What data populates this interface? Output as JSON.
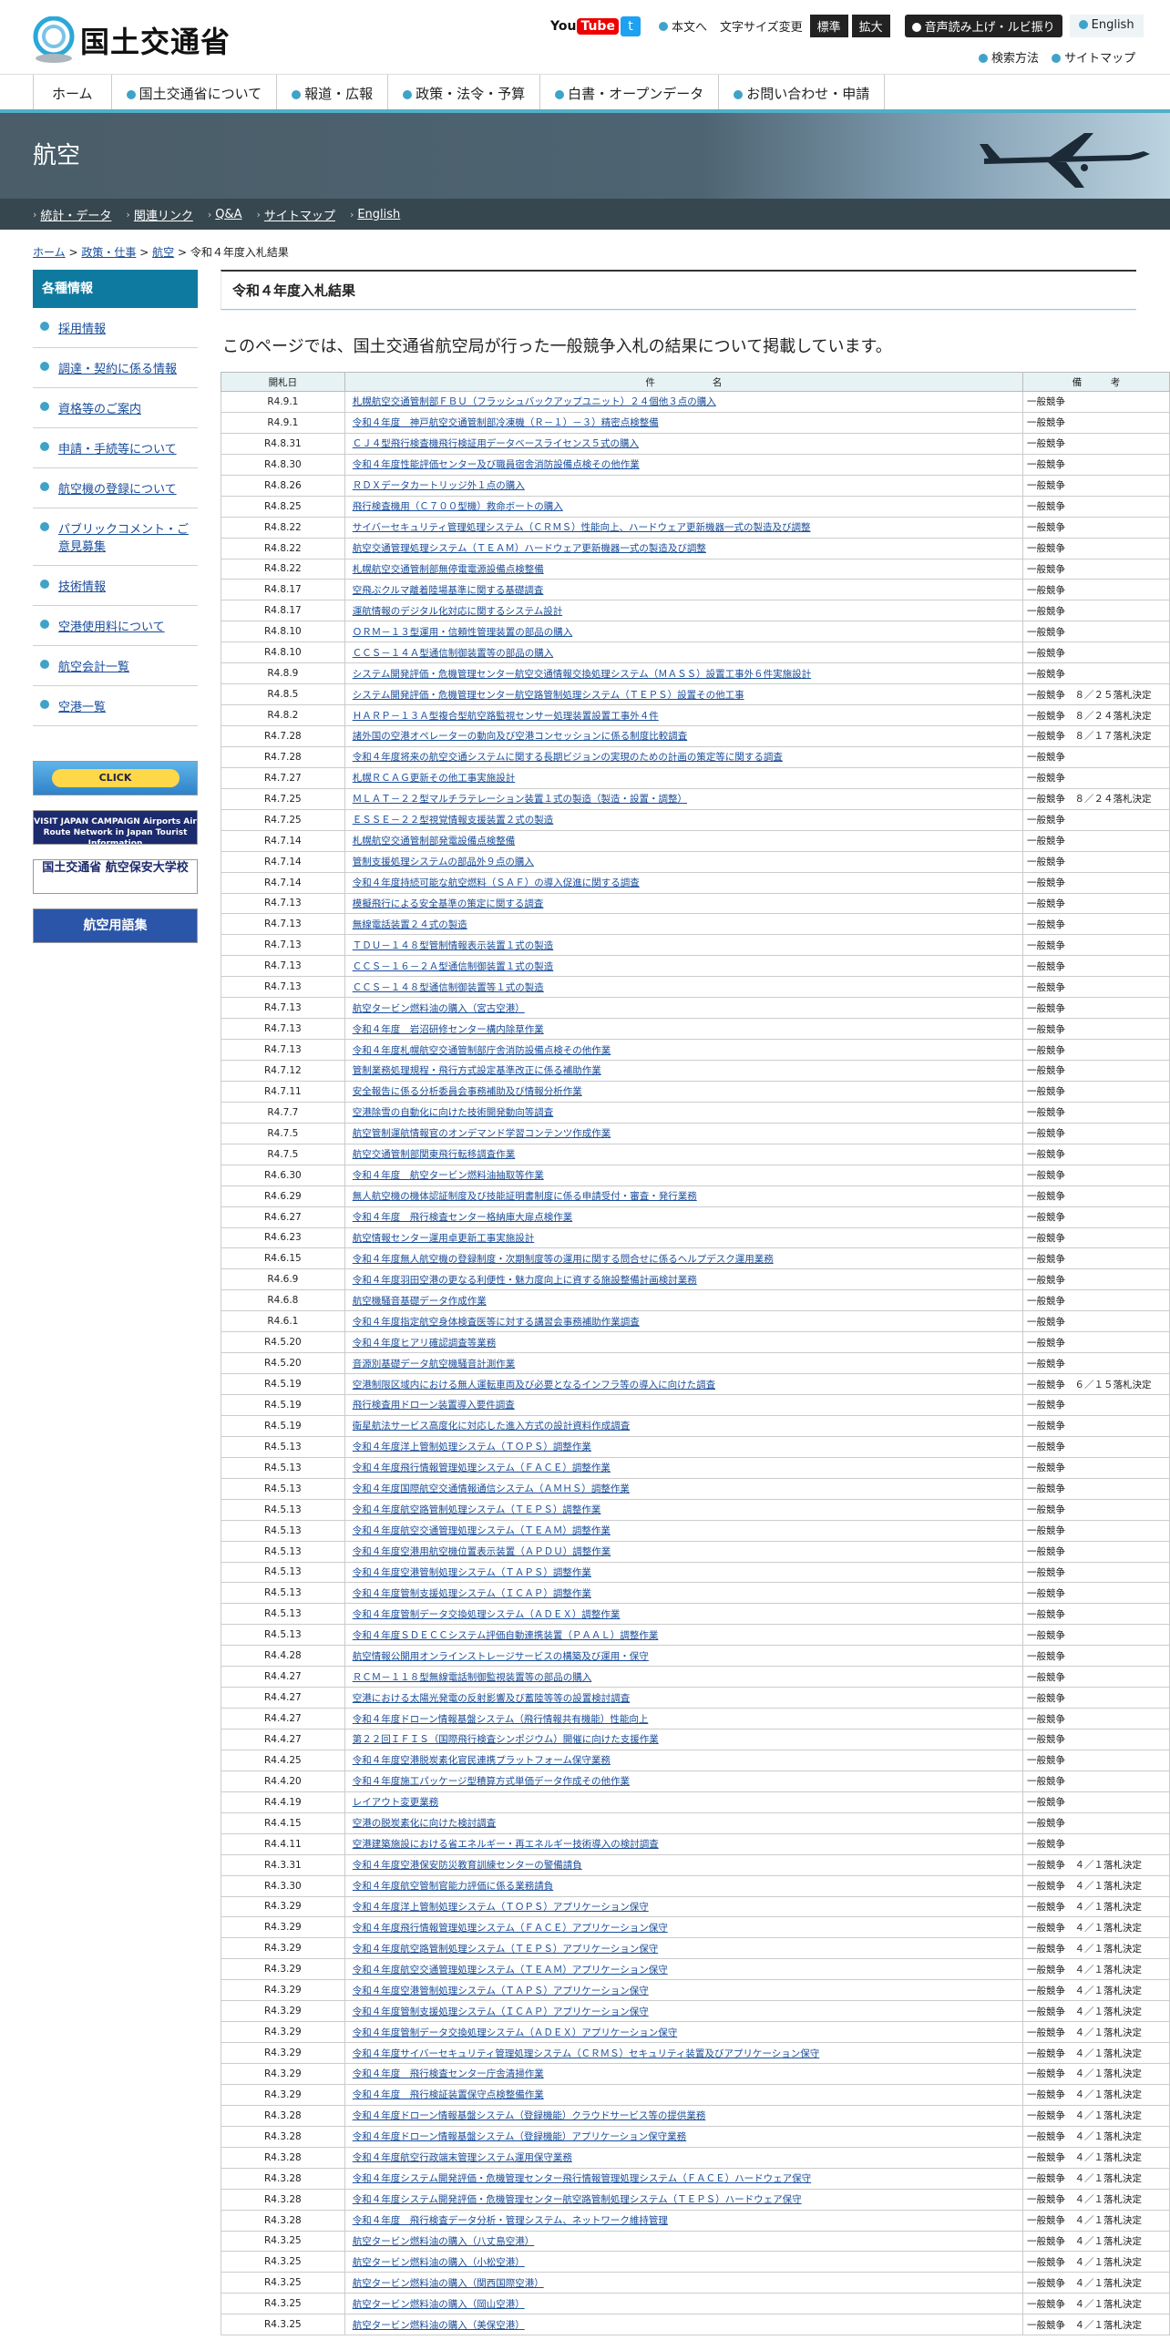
{
  "header": {
    "logo_text": "国土交通省",
    "youtube": "You",
    "youtube_tube": "Tube",
    "twitter": "t",
    "honbun": "本文へ",
    "fontsize": "文字サイズ変更",
    "std": "標準",
    "large": "拡大",
    "voice": "音声読み上げ・ルビ振り",
    "english": "English",
    "search": "検索方法",
    "sitemap": "サイトマップ"
  },
  "gnav": [
    "ホーム",
    "国土交通省について",
    "報道・広報",
    "政策・法令・予算",
    "白書・オープンデータ",
    "お問い合わせ・申請"
  ],
  "banner": {
    "title": "航空"
  },
  "subnav": [
    "統計・データ",
    "関連リンク",
    "Q&A",
    "サイトマップ",
    "English"
  ],
  "crumbs": {
    "home": "ホーム",
    "policy": "政策・仕事",
    "aviation": "航空",
    "current": "令和４年度入札結果",
    "sep": ">"
  },
  "sidebar": {
    "header": "各種情報",
    "items": [
      "採用情報",
      "調達・契約に係る情報",
      "資格等のご案内",
      "申請・手続等について",
      "航空機の登録について",
      "パブリックコメント・ご意見募集",
      "技術情報",
      "空港使用料について",
      "航空会計一覧",
      "空港一覧"
    ],
    "banners": [
      "CLICK",
      "VISIT JAPAN CAMPAIGN Airports Air Route Network in Japan Tourist Information",
      "国土交通省 航空保安大学校",
      "航空用語集"
    ]
  },
  "main": {
    "title": "令和４年度入札結果",
    "intro": "このページでは、国土交通省航空局が行った一般競争入札の結果について掲載しています。",
    "th": [
      "開札日",
      "件　　　　　　名",
      "備　　　考"
    ]
  },
  "rows": [
    [
      "R4.9.1",
      "札幌航空交通管制部ＦＢＵ（フラッシュバックアップユニット）２４個他３点の購入",
      "一般競争"
    ],
    [
      "R4.9.1",
      "令和４年度　神戸航空交通管制部冷凍機（Ｒ－１）－３）精密点検整備",
      "一般競争"
    ],
    [
      "R4.8.31",
      "ＣＪ４型飛行検査機飛行検証用データベースライセンス５式の購入",
      "一般競争"
    ],
    [
      "R4.8.30",
      "令和４年度性能評価センター及び職員宿舎消防設備点検その他作業",
      "一般競争"
    ],
    [
      "R4.8.26",
      "ＲＤＸデータカートリッジ外１点の購入",
      "一般競争"
    ],
    [
      "R4.8.25",
      "飛行検査機用（Ｃ７００型機）救命ボートの購入",
      "一般競争"
    ],
    [
      "R4.8.22",
      "サイバーセキュリティ管理処理システム（ＣＲＭＳ）性能向上、ハードウェア更新機器一式の製造及び調整",
      "一般競争"
    ],
    [
      "R4.8.22",
      "航空交通管理処理システム（ＴＥＡＭ）ハードウェア更新機器一式の製造及び調整",
      "一般競争"
    ],
    [
      "R4.8.22",
      "札幌航空交通管制部無停電電源設備点検整備",
      "一般競争"
    ],
    [
      "R4.8.17",
      "空飛ぶクルマ離着陸場基準に関する基礎調査",
      "一般競争"
    ],
    [
      "R4.8.17",
      "運航情報のデジタル化対応に関するシステム設計",
      "一般競争"
    ],
    [
      "R4.8.10",
      "ＯＲＭ－１３型運用・信頼性管理装置の部品の購入",
      "一般競争"
    ],
    [
      "R4.8.10",
      "ＣＣＳ－１４Ａ型通信制御装置等の部品の購入",
      "一般競争"
    ],
    [
      "R4.8.9",
      "システム開発評価・危機管理センター航空交通情報交換処理システム（ＭＡＳＳ）設置工事外６件実施設計",
      "一般競争"
    ],
    [
      "R4.8.5",
      "システム開発評価・危機管理センター航空路管制処理システム（ＴＥＰＳ）設置その他工事",
      "一般競争　８／２５落札決定"
    ],
    [
      "R4.8.2",
      "ＨＡＲＰ－１３Ａ型複合型航空路監視センサー処理装置設置工事外４件",
      "一般競争　８／２４落札決定"
    ],
    [
      "R4.7.28",
      "諸外国の空港オペレーターの動向及び空港コンセッションに係る制度比較調査",
      "一般競争　８／１７落札決定"
    ],
    [
      "R4.7.28",
      "令和４年度将来の航空交通システムに関する長期ビジョンの実現のための計画の策定等に関する調査",
      "一般競争"
    ],
    [
      "R4.7.27",
      "札幌ＲＣＡＧ更新その他工事実施設計",
      "一般競争"
    ],
    [
      "R4.7.25",
      "ＭＬＡＴ－２２型マルチラテレーション装置１式の製造（製造・設置・調整）",
      "一般競争　８／２４落札決定"
    ],
    [
      "R4.7.25",
      "ＥＳＳＥ－２２型視覚情報支援装置２式の製造",
      "一般競争"
    ],
    [
      "R4.7.14",
      "札幌航空交通管制部発電設備点検整備",
      "一般競争"
    ],
    [
      "R4.7.14",
      "管制支援処理システムの部品外９点の購入",
      "一般競争"
    ],
    [
      "R4.7.14",
      "令和４年度持続可能な航空燃料（ＳＡＦ）の導入促進に関する調査",
      "一般競争"
    ],
    [
      "R4.7.13",
      "模擬飛行による安全基準の策定に関する調査",
      "一般競争"
    ],
    [
      "R4.7.13",
      "無線電話装置２４式の製造",
      "一般競争"
    ],
    [
      "R4.7.13",
      "ＴＤＵ－１４８型管制情報表示装置１式の製造",
      "一般競争"
    ],
    [
      "R4.7.13",
      "ＣＣＳ－１６－２Ａ型通信制御装置１式の製造",
      "一般競争"
    ],
    [
      "R4.7.13",
      "ＣＣＳ－１４８型通信制御装置等１式の製造",
      "一般競争"
    ],
    [
      "R4.7.13",
      "航空タービン燃料油の購入（宮古空港）",
      "一般競争"
    ],
    [
      "R4.7.13",
      "令和４年度　岩沼研修センター構内除草作業",
      "一般競争"
    ],
    [
      "R4.7.13",
      "令和４年度札幌航空交通管制部庁舎消防設備点検その他作業",
      "一般競争"
    ],
    [
      "R4.7.12",
      "管制業務処理規程・飛行方式設定基準改正に係る補助作業",
      "一般競争"
    ],
    [
      "R4.7.11",
      "安全報告に係る分析委員会事務補助及び情報分析作業",
      "一般競争"
    ],
    [
      "R4.7.7",
      "空港除雪の自動化に向けた技術開発動向等調査",
      "一般競争"
    ],
    [
      "R4.7.5",
      "航空管制運航情報官のオンデマンド学習コンテンツ作成作業",
      "一般競争"
    ],
    [
      "R4.7.5",
      "航空交通管制部関東飛行転移調査作業",
      "一般競争"
    ],
    [
      "R4.6.30",
      "令和４年度　航空タービン燃料油抽取等作業",
      "一般競争"
    ],
    [
      "R4.6.29",
      "無人航空機の機体認証制度及び技能証明書制度に係る申請受付・審査・発行業務",
      "一般競争"
    ],
    [
      "R4.6.27",
      "令和４年度　飛行検査センター格納庫大扉点検作業",
      "一般競争"
    ],
    [
      "R4.6.23",
      "航空情報センター運用卓更新工事実施設計",
      "一般競争"
    ],
    [
      "R4.6.15",
      "令和４年度無人航空機の登録制度・次期制度等の運用に関する問合せに係るヘルプデスク運用業務",
      "一般競争"
    ],
    [
      "R4.6.9",
      "令和４年度羽田空港の更なる利便性・魅力度向上に資する施設整備計画検討業務",
      "一般競争"
    ],
    [
      "R4.6.8",
      "航空機騒音基礎データ作成作業",
      "一般競争"
    ],
    [
      "R4.6.1",
      "令和４年度指定航空身体検査医等に対する講習会事務補助作業調査",
      "一般競争"
    ],
    [
      "R4.5.20",
      "令和４年度ヒアリ確認調査等業務",
      "一般競争"
    ],
    [
      "R4.5.20",
      "音源別基礎データ航空機騒音計測作業",
      "一般競争"
    ],
    [
      "R4.5.19",
      "空港制限区域内における無人運転車両及び必要となるインフラ等の導入に向けた調査",
      "一般競争　６／１５落札決定"
    ],
    [
      "R4.5.19",
      "飛行検査用ドローン装置導入要件調査",
      "一般競争"
    ],
    [
      "R4.5.19",
      "衛星航法サービス高度化に対応した進入方式の設計資料作成調査",
      "一般競争"
    ],
    [
      "R4.5.13",
      "令和４年度洋上管制処理システム（ＴＯＰＳ）調整作業",
      "一般競争"
    ],
    [
      "R4.5.13",
      "令和４年度飛行情報管理処理システム（ＦＡＣＥ）調整作業",
      "一般競争"
    ],
    [
      "R4.5.13",
      "令和４年度国際航空交通情報通信システム（ＡＭＨＳ）調整作業",
      "一般競争"
    ],
    [
      "R4.5.13",
      "令和４年度航空路管制処理システム（ＴＥＰＳ）調整作業",
      "一般競争"
    ],
    [
      "R4.5.13",
      "令和４年度航空交通管理処理システム（ＴＥＡＭ）調整作業",
      "一般競争"
    ],
    [
      "R4.5.13",
      "令和４年度空港用航空機位置表示装置（ＡＰＤＵ）調整作業",
      "一般競争"
    ],
    [
      "R4.5.13",
      "令和４年度空港管制処理システム（ＴＡＰＳ）調整作業",
      "一般競争"
    ],
    [
      "R4.5.13",
      "令和４年度管制支援処理システム（ＩＣＡＰ）調整作業",
      "一般競争"
    ],
    [
      "R4.5.13",
      "令和４年度管制データ交換処理システム（ＡＤＥＸ）調整作業",
      "一般競争"
    ],
    [
      "R4.5.13",
      "令和４年度ＳＤＥＣＣシステム評価自動連携装置（ＰＡＡＬ）調整作業",
      "一般競争"
    ],
    [
      "R4.4.28",
      "航空情報公開用オンラインストレージサービスの構築及び運用・保守",
      "一般競争"
    ],
    [
      "R4.4.27",
      "ＲＣＭ－１１８型無線電話制御監視装置等の部品の購入",
      "一般競争"
    ],
    [
      "R4.4.27",
      "空港における太陽光発電の反射影響及び蓄陸等等の設置検討調査",
      "一般競争"
    ],
    [
      "R4.4.27",
      "令和４年度ドローン情報基盤システム（飛行情報共有機能）性能向上",
      "一般競争"
    ],
    [
      "R4.4.27",
      "第２２回ＩＦＩＳ（国際飛行検査シンポジウム）開催に向けた支援作業",
      "一般競争"
    ],
    [
      "R4.4.25",
      "令和４年度空港脱炭素化官民連携プラットフォーム保守業務",
      "一般競争"
    ],
    [
      "R4.4.20",
      "令和４年度施工パッケージ型積算方式単価データ作成その他作業",
      "一般競争"
    ],
    [
      "R4.4.19",
      "レイアウト変更業務",
      "一般競争"
    ],
    [
      "R4.4.15",
      "空港の脱炭素化に向けた検討調査",
      "一般競争"
    ],
    [
      "R4.4.11",
      "空港建築施設における省エネルギー・再エネルギー技術導入の検討調査",
      "一般競争"
    ],
    [
      "R4.3.31",
      "令和４年度空港保安防災教育訓練センターの警備請負",
      "一般競争　４／１落札決定"
    ],
    [
      "R4.3.30",
      "令和４年度航空管制官能力評価に係る業務請負",
      "一般競争　４／１落札決定"
    ],
    [
      "R4.3.29",
      "令和４年度洋上管制処理システム（ＴＯＰＳ）アプリケーション保守",
      "一般競争　４／１落札決定"
    ],
    [
      "R4.3.29",
      "令和４年度飛行情報管理処理システム（ＦＡＣＥ）アプリケーション保守",
      "一般競争　４／１落札決定"
    ],
    [
      "R4.3.29",
      "令和４年度航空路管制処理システム（ＴＥＰＳ）アプリケーション保守",
      "一般競争　４／１落札決定"
    ],
    [
      "R4.3.29",
      "令和４年度航空交通管理処理システム（ＴＥＡＭ）アプリケーション保守",
      "一般競争　４／１落札決定"
    ],
    [
      "R4.3.29",
      "令和４年度空港管制処理システム（ＴＡＰＳ）アプリケーション保守",
      "一般競争　４／１落札決定"
    ],
    [
      "R4.3.29",
      "令和４年度管制支援処理システム（ＩＣＡＰ）アプリケーション保守",
      "一般競争　４／１落札決定"
    ],
    [
      "R4.3.29",
      "令和４年度管制データ交換処理システム（ＡＤＥＸ）アプリケーション保守",
      "一般競争　４／１落札決定"
    ],
    [
      "R4.3.29",
      "令和４年度サイバーセキュリティ管理処理システム（ＣＲＭＳ）セキュリティ装置及びアプリケーション保守",
      "一般競争　４／１落札決定"
    ],
    [
      "R4.3.29",
      "令和４年度　飛行検査センター庁舎清掃作業",
      "一般競争　４／１落札決定"
    ],
    [
      "R4.3.29",
      "令和４年度　飛行検証装置保守点検整備作業",
      "一般競争　４／１落札決定"
    ],
    [
      "R4.3.28",
      "令和４年度ドローン情報基盤システム（登録機能）クラウドサービス等の提供業務",
      "一般競争　４／１落札決定"
    ],
    [
      "R4.3.28",
      "令和４年度ドローン情報基盤システム（登録機能）アプリケーション保守業務",
      "一般競争　４／１落札決定"
    ],
    [
      "R4.3.28",
      "令和４年度航空行政端末管理システム運用保守業務",
      "一般競争　４／１落札決定"
    ],
    [
      "R4.3.28",
      "令和４年度システム開発評価・危機管理センター飛行情報管理処理システム（ＦＡＣＥ）ハードウェア保守",
      "一般競争　４／１落札決定"
    ],
    [
      "R4.3.28",
      "令和４年度システム開発評価・危機管理センター航空路管制処理システム（ＴＥＰＳ）ハードウェア保守",
      "一般競争　４／１落札決定"
    ],
    [
      "R4.3.28",
      "令和４年度　飛行検査データ分析・管理システム、ネットワーク維持管理",
      "一般競争　４／１落札決定"
    ],
    [
      "R4.3.25",
      "航空タービン燃料油の購入（八丈島空港）",
      "一般競争　４／１落札決定"
    ],
    [
      "R4.3.25",
      "航空タービン燃料油の購入（小松空港）",
      "一般競争　４／１落札決定"
    ],
    [
      "R4.3.25",
      "航空タービン燃料油の購入（関西国際空港）",
      "一般競争　４／１落札決定"
    ],
    [
      "R4.3.25",
      "航空タービン燃料油の購入（岡山空港）",
      "一般競争　４／１落札決定"
    ],
    [
      "R4.3.25",
      "航空タービン燃料油の購入（美保空港）",
      "一般競争　４／１落札決定"
    ]
  ]
}
